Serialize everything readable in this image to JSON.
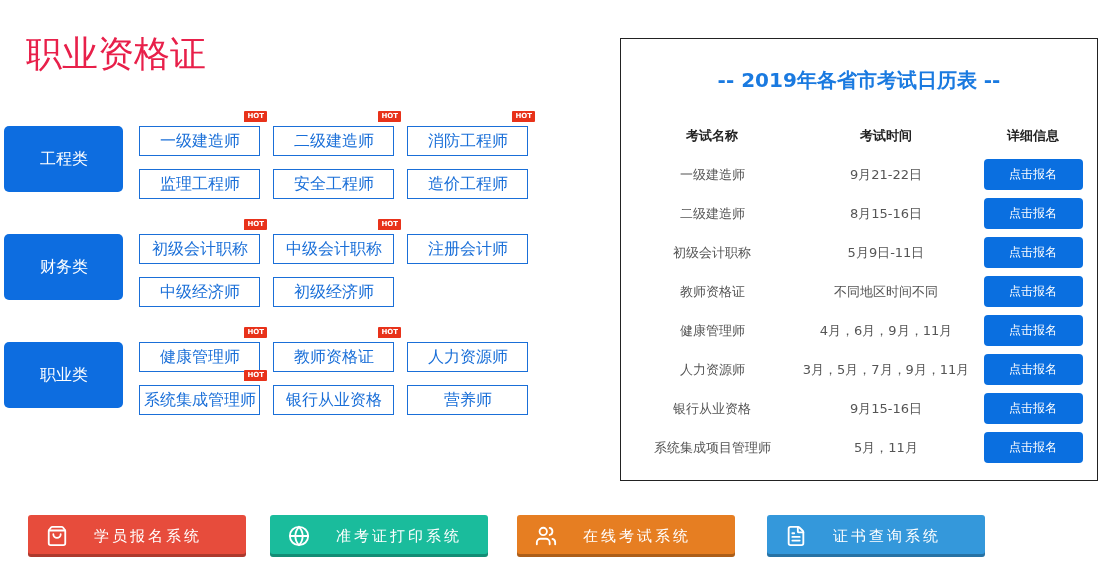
{
  "title": "职业资格证",
  "categories": [
    {
      "label": "工程类",
      "items": [
        {
          "label": "一级建造师",
          "badge": "HOT"
        },
        {
          "label": "二级建造师",
          "badge": "HOT"
        },
        {
          "label": "消防工程师",
          "badge": "HOT"
        },
        {
          "label": "监理工程师"
        },
        {
          "label": "安全工程师"
        },
        {
          "label": "造价工程师"
        }
      ]
    },
    {
      "label": "财务类",
      "items": [
        {
          "label": "初级会计职称",
          "badge": "HOT"
        },
        {
          "label": "中级会计职称",
          "badge": "HOT"
        },
        {
          "label": "注册会计师"
        },
        {
          "label": "中级经济师"
        },
        {
          "label": "初级经济师"
        }
      ]
    },
    {
      "label": "职业类",
      "items": [
        {
          "label": "健康管理师",
          "badge": "HOT"
        },
        {
          "label": "教师资格证",
          "badge": "HOT"
        },
        {
          "label": "人力资源师"
        },
        {
          "label": "系统集成管理师",
          "badge": "HOT"
        },
        {
          "label": "银行从业资格"
        },
        {
          "label": "营养师"
        }
      ]
    }
  ],
  "calendar": {
    "title": "-- 2019年各省市考试日历表 --",
    "columns": [
      "考试名称",
      "考试时间",
      "详细信息"
    ],
    "rows": [
      {
        "name": "一级建造师",
        "time": "9月21-22日",
        "action": "点击报名"
      },
      {
        "name": "二级建造师",
        "time": "8月15-16日",
        "action": "点击报名"
      },
      {
        "name": "初级会计职称",
        "time": "5月9日-11日",
        "action": "点击报名"
      },
      {
        "name": "教师资格证",
        "time": "不同地区时间不同",
        "action": "点击报名"
      },
      {
        "name": "健康管理师",
        "time": "4月，6月，9月，11月",
        "action": "点击报名"
      },
      {
        "name": "人力资源师",
        "time": "3月，5月，7月，9月，11月",
        "action": "点击报名"
      },
      {
        "name": "银行从业资格",
        "time": "9月15-16日",
        "action": "点击报名"
      },
      {
        "name": "系统集成项目管理师",
        "time": "5月，11月",
        "action": "点击报名"
      }
    ]
  },
  "systems": [
    {
      "label": "学员报名系统",
      "color": "#e74c3c"
    },
    {
      "label": "准考证打印系统",
      "color": "#1abc9c"
    },
    {
      "label": "在线考试系统",
      "color": "#e67e22"
    },
    {
      "label": "证书查询系统",
      "color": "#3498db"
    }
  ]
}
